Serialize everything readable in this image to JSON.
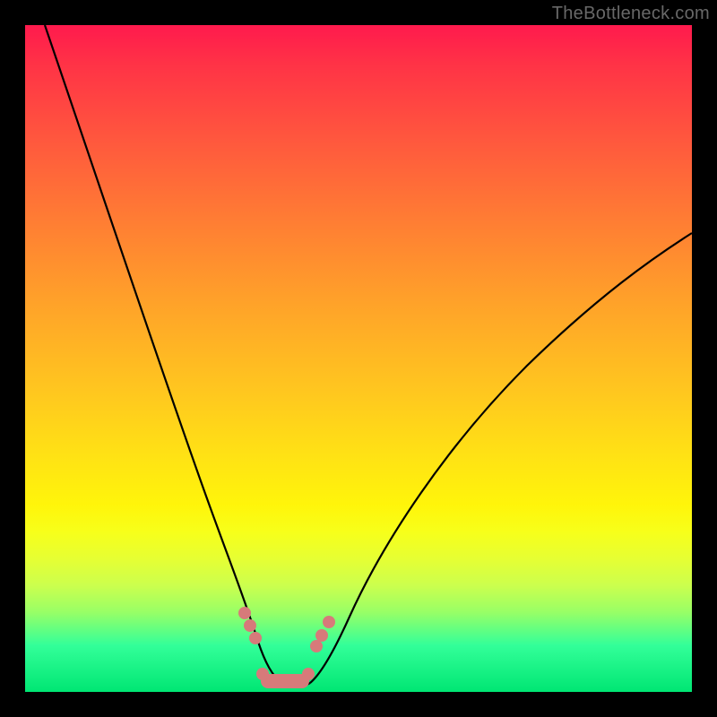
{
  "watermark": "TheBottleneck.com",
  "chart_data": {
    "type": "line",
    "title": "",
    "xlabel": "",
    "ylabel": "",
    "xlim": [
      0,
      100
    ],
    "ylim": [
      0,
      100
    ],
    "series": [
      {
        "name": "left-branch",
        "x": [
          3,
          10,
          18,
          24,
          28,
          31,
          33,
          34.5,
          36
        ],
        "y": [
          100,
          78,
          54,
          36,
          24,
          15,
          9,
          5,
          2
        ]
      },
      {
        "name": "right-branch",
        "x": [
          42,
          44,
          46,
          50,
          56,
          64,
          74,
          86,
          100
        ],
        "y": [
          2,
          5,
          9,
          16,
          26,
          38,
          50,
          60,
          68
        ]
      }
    ],
    "valley_floor": {
      "x_start": 36,
      "x_end": 42,
      "y": 1
    },
    "markers": {
      "left_dots_x": [
        32.5,
        33.3,
        34.0
      ],
      "right_dots_x": [
        43.0,
        44.0,
        45.3
      ],
      "dot_y_approx": [
        10,
        8.4,
        6.8
      ],
      "floor_segment_x": [
        35.0,
        41.5
      ],
      "floor_y": 1.3
    },
    "colors": {
      "marker": "#d77a7a",
      "curve": "#000000"
    }
  }
}
